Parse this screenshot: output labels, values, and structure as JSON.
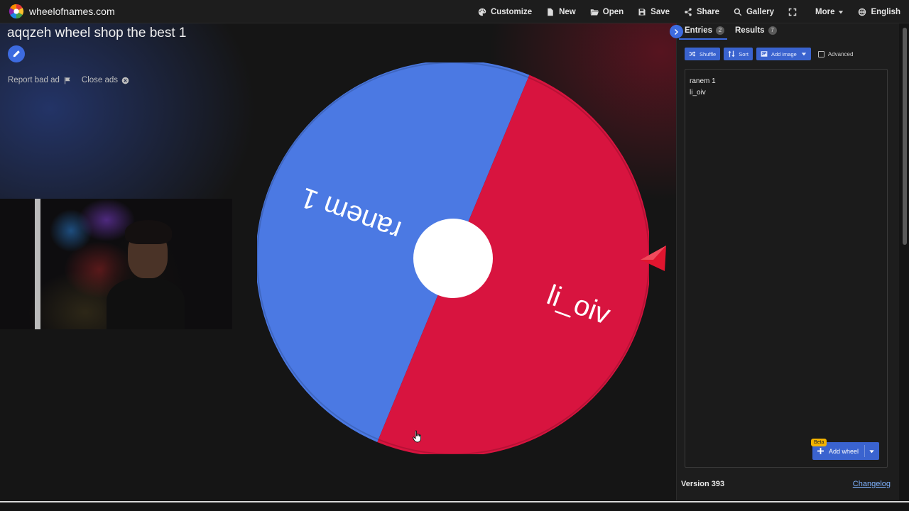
{
  "site": {
    "name": "wheelofnames.com"
  },
  "menu": {
    "customize": "Customize",
    "new": "New",
    "open": "Open",
    "save": "Save",
    "share": "Share",
    "gallery": "Gallery",
    "more": "More",
    "language": "English"
  },
  "wheel": {
    "title": "aqqzeh wheel shop the best 1",
    "segments": [
      {
        "label": "ranem 1",
        "color": "#4b79e3"
      },
      {
        "label": "li_oiv",
        "color": "#d8143f"
      }
    ],
    "hub_color": "#ffffff",
    "pointer_color": "#e0152f"
  },
  "ads": {
    "report": "Report bad ad",
    "close": "Close ads"
  },
  "panel": {
    "tabs": {
      "entries": {
        "label": "Entries",
        "count": "2"
      },
      "results": {
        "label": "Results",
        "count": "7"
      }
    },
    "toolbar": {
      "shuffle": "Shuffle",
      "sort": "Sort",
      "add_image": "Add image",
      "advanced": "Advanced"
    },
    "entries": [
      "ranem 1",
      "li_oiv"
    ],
    "add_wheel": "Add wheel",
    "beta": "Beta",
    "version": "Version 393",
    "changelog": "Changelog"
  },
  "colors": {
    "accent": "#3d6be0",
    "background": "#141414",
    "panel": "#1d1d1d"
  }
}
